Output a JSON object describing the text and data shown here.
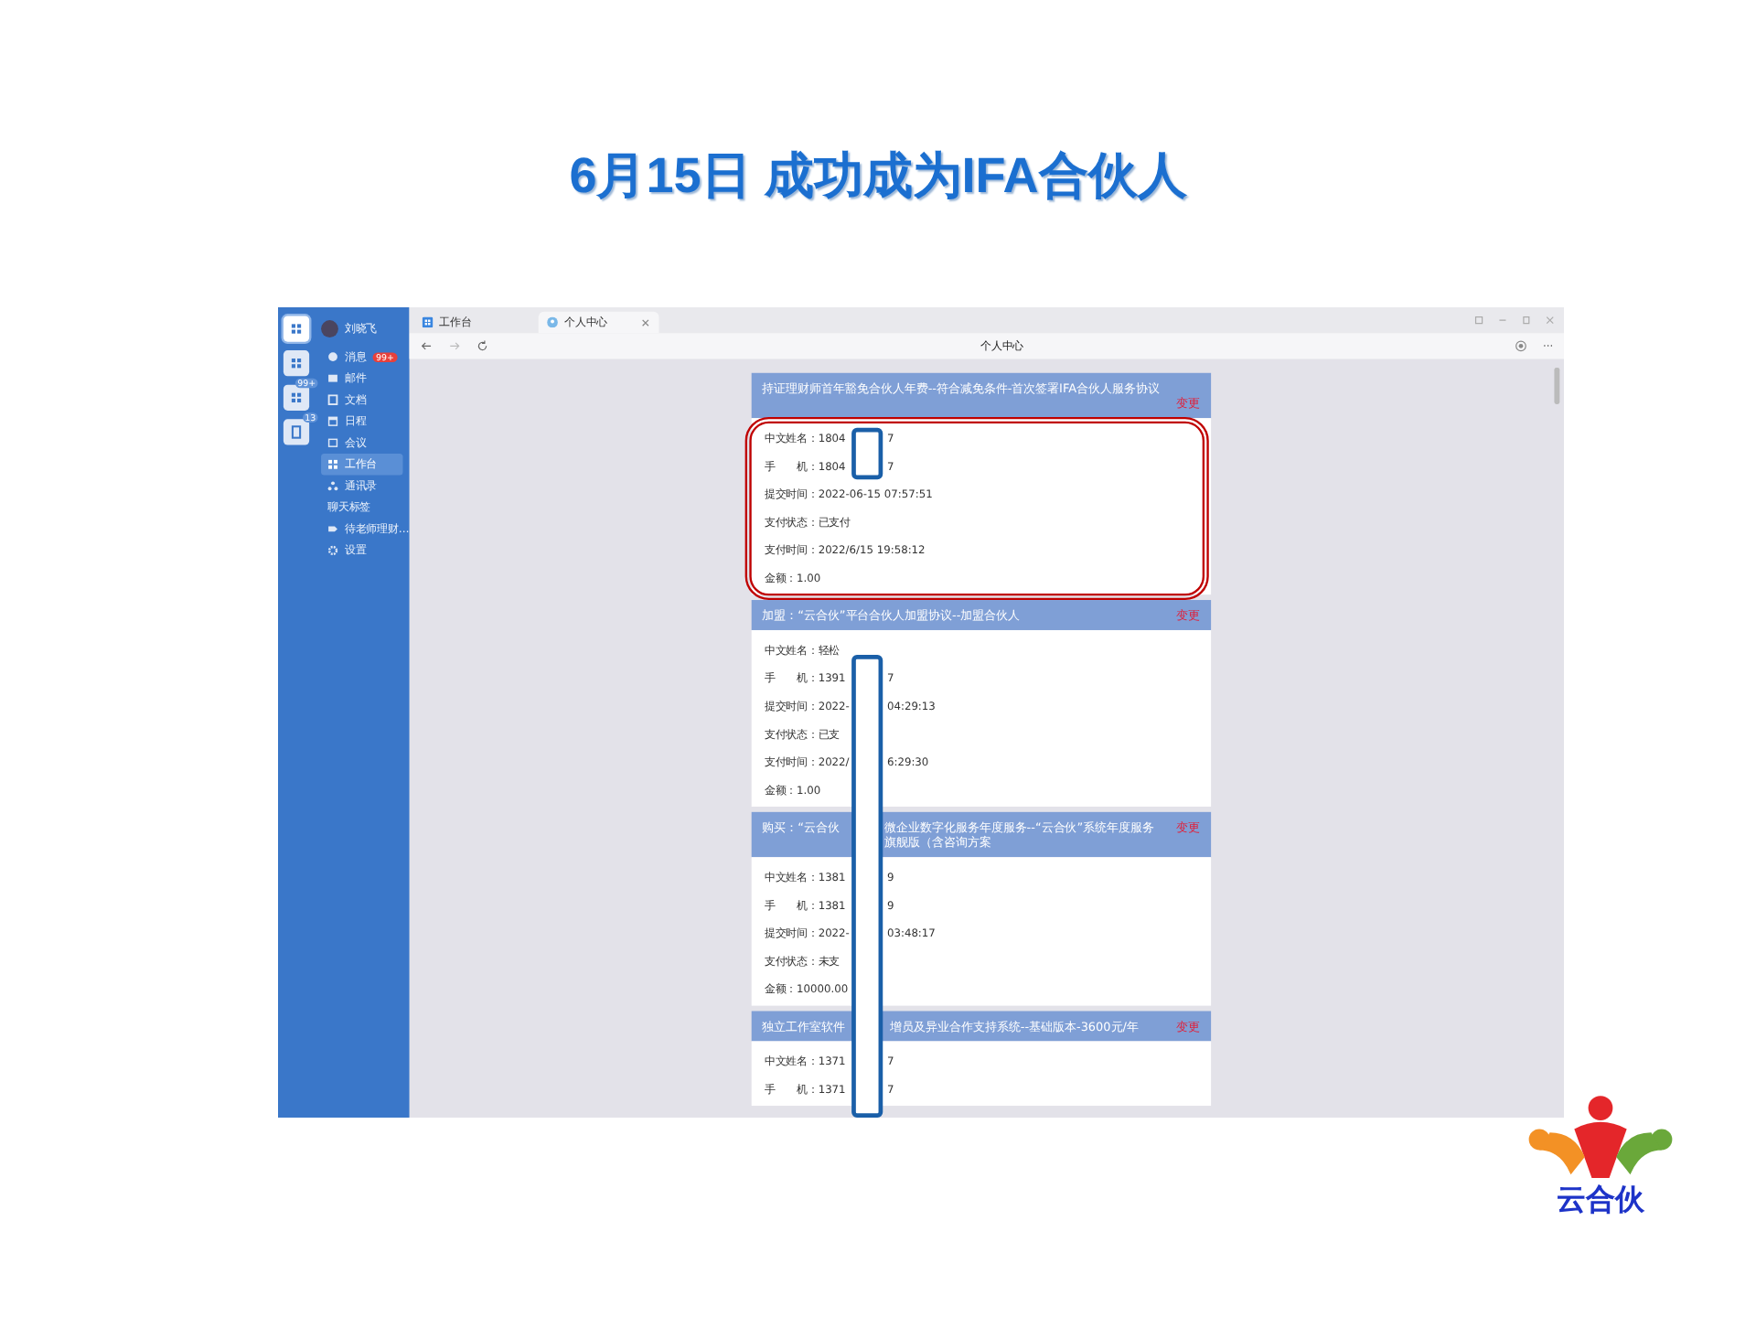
{
  "slide": {
    "title": "6月15日 成功成为IFA合伙人",
    "logo_text": "云合伙"
  },
  "rail": {
    "items": [
      {
        "kind": "apps",
        "selected": true
      },
      {
        "kind": "apps",
        "selected": false
      },
      {
        "kind": "apps",
        "selected": false,
        "badge": "99+"
      },
      {
        "kind": "docs",
        "selected": false,
        "badge": "13"
      }
    ]
  },
  "sidebar": {
    "user": "刘晓飞",
    "items": [
      {
        "kind": "chat",
        "label": "消息",
        "badge": "99+",
        "selected": false
      },
      {
        "kind": "mail",
        "label": "邮件",
        "selected": false
      },
      {
        "kind": "docs",
        "label": "文档",
        "selected": false
      },
      {
        "kind": "calendar",
        "label": "日程",
        "selected": false
      },
      {
        "kind": "meeting",
        "label": "会议",
        "selected": false
      },
      {
        "kind": "apps",
        "label": "工作台",
        "selected": true
      },
      {
        "kind": "contacts",
        "label": "通讯录",
        "selected": false
      },
      {
        "kind": "plain",
        "label": "聊天标签",
        "selected": false
      },
      {
        "kind": "tag",
        "label": "待老师理财…",
        "selected": false
      },
      {
        "kind": "settings",
        "label": "设置",
        "selected": false
      }
    ]
  },
  "tabs": [
    {
      "label": "工作台",
      "selected": false
    },
    {
      "label": "个人中心",
      "selected": true
    }
  ],
  "toolbar": {
    "page_title": "个人中心",
    "more": "···"
  },
  "cards": [
    {
      "title": "持证理财师首年豁免合伙人年费--符合减免条件-首次签署IFA合伙人服务协议",
      "action": "变更",
      "rows": [
        {
          "label": "中文姓名：",
          "value": "1804",
          "value_tail": "7"
        },
        {
          "label": "手　　机：",
          "value": "1804",
          "value_tail": "7"
        },
        {
          "label": "提交时间：",
          "value": "2022-06-15 07:57:51"
        },
        {
          "label": "支付状态：",
          "value": "已支付"
        },
        {
          "label": "支付时间：",
          "value": "2022/6/15 19:58:12"
        },
        {
          "label": "金额：",
          "value": "1.00"
        }
      ]
    },
    {
      "title": "加盟：“云合伙”平台合伙人加盟协议--加盟合伙人",
      "action": "变更",
      "rows": [
        {
          "label": "中文姓名：",
          "value": "轻松"
        },
        {
          "label": "手　　机：",
          "value": "1391",
          "value_tail": "7"
        },
        {
          "label": "提交时间：",
          "value": "2022-",
          "value_tail": "04:29:13"
        },
        {
          "label": "支付状态：",
          "value": "已支"
        },
        {
          "label": "支付时间：",
          "value": "2022/",
          "value_tail": "6:29:30"
        },
        {
          "label": "金额：",
          "value": "1.00"
        }
      ]
    },
    {
      "title": "购买：“云合伙",
      "title_tail": "微企业数字化服务年度服务--“云合伙”系统年度服务旗舰版（含咨询方案",
      "action": "变更",
      "rows": [
        {
          "label": "中文姓名：",
          "value": "1381",
          "value_tail": "9"
        },
        {
          "label": "手　　机：",
          "value": "1381",
          "value_tail": "9"
        },
        {
          "label": "提交时间：",
          "value": "2022-",
          "value_tail": "03:48:17"
        },
        {
          "label": "支付状态：",
          "value": "未支"
        },
        {
          "label": "金额：",
          "value": "10000.00"
        }
      ]
    },
    {
      "title": "独立工作室软件",
      "title_tail": "增员及异业合作支持系统--基础版本-3600元/年",
      "action": "变更",
      "rows": [
        {
          "label": "中文姓名：",
          "value": "1371",
          "value_tail": "7"
        },
        {
          "label": "手　　机：",
          "value": "1371",
          "value_tail": "7"
        }
      ]
    }
  ]
}
